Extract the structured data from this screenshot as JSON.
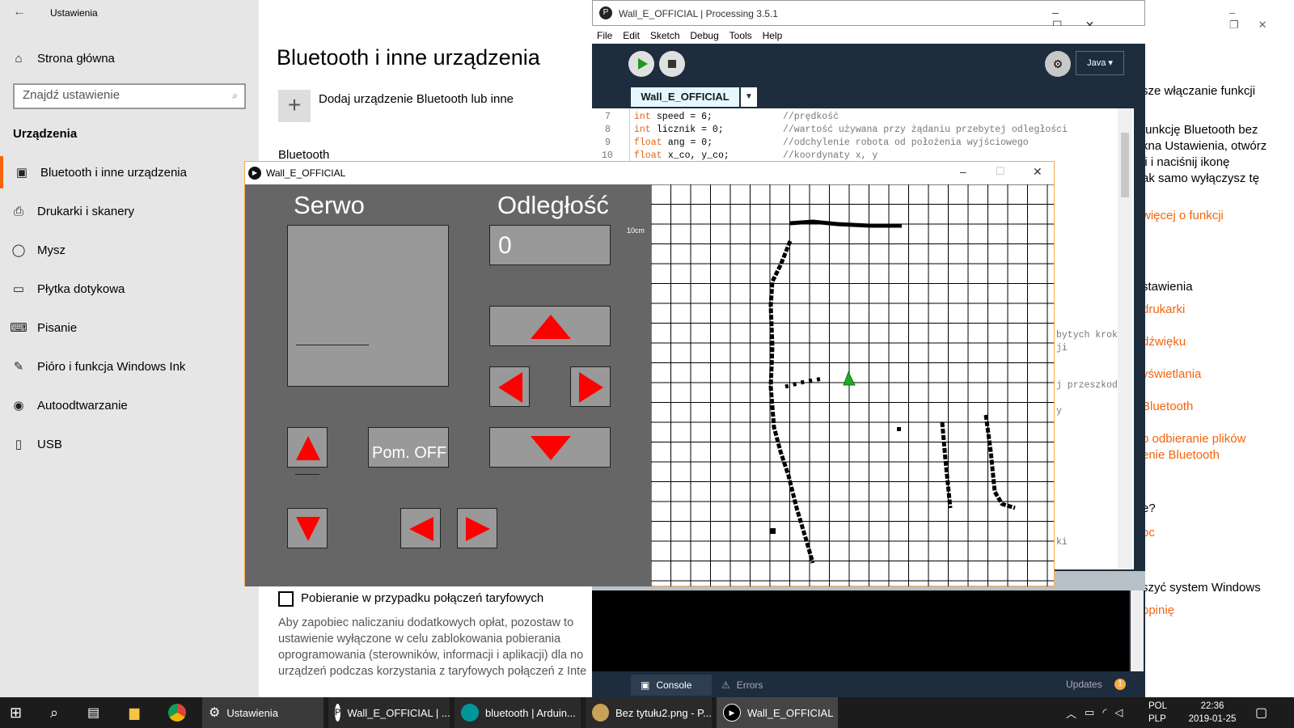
{
  "settings": {
    "window_title": "Ustawienia",
    "home": "Strona główna",
    "search_placeholder": "Znajdź ustawienie",
    "section": "Urządzenia",
    "items": [
      {
        "label": "Bluetooth i inne urządzenia",
        "icon": "bluetooth-devices-icon"
      },
      {
        "label": "Drukarki i skanery",
        "icon": "printer-icon"
      },
      {
        "label": "Mysz",
        "icon": "mouse-icon"
      },
      {
        "label": "Płytka dotykowa",
        "icon": "touchpad-icon"
      },
      {
        "label": "Pisanie",
        "icon": "keyboard-icon"
      },
      {
        "label": "Pióro i funkcja Windows Ink",
        "icon": "pen-icon"
      },
      {
        "label": "Autoodtwarzanie",
        "icon": "autoplay-icon"
      },
      {
        "label": "USB",
        "icon": "usb-icon"
      }
    ],
    "main_title": "Bluetooth i inne urządzenia",
    "add_device": "Dodaj urządzenie Bluetooth lub inne",
    "bluetooth_label": "Bluetooth",
    "metered_label": "Pobieranie w przypadku połączeń taryfowych",
    "metered_desc": [
      "Aby zapobiec naliczaniu dodatkowych opłat, pozostaw to",
      "ustawienie wyłączone w celu zablokowania pobierania",
      "oprogramowania (sterowników, informacji i aplikacji) dla no",
      "urządzeń podczas korzystania z taryfowych połączeń z Inte"
    ],
    "right_strip": [
      {
        "text": "sze włączanie funkcji",
        "link": false
      },
      {
        "text": "funkcję Bluetooth bez",
        "link": false
      },
      {
        "text": "kna Ustawienia, otwórz",
        "link": false
      },
      {
        "text": "ji i naciśnij ikonę",
        "link": false
      },
      {
        "text": "ak samo wyłączysz tę",
        "link": false
      },
      {
        "text": "więcej o funkcji",
        "link": true
      },
      {
        "text": "stawienia",
        "link": false
      },
      {
        "text": "drukarki",
        "link": true
      },
      {
        "text": "dźwięku",
        "link": true
      },
      {
        "text": "yświetlania",
        "link": true
      },
      {
        "text": "Bluetooth",
        "link": true
      },
      {
        "text": "b odbieranie plików",
        "link": true
      },
      {
        "text": "enie Bluetooth",
        "link": true
      },
      {
        "text": "e?",
        "link": false
      },
      {
        "text": "oc",
        "link": true
      },
      {
        "text": "szyć system Windows",
        "link": false
      },
      {
        "text": "opinię",
        "link": true
      }
    ]
  },
  "ide": {
    "title": "Wall_E_OFFICIAL | Processing 3.5.1",
    "menu": [
      "File",
      "Edit",
      "Sketch",
      "Debug",
      "Tools",
      "Help"
    ],
    "mode": "Java ▾",
    "tab": "Wall_E_OFFICIAL",
    "code": [
      {
        "num": "7",
        "type": "int",
        "rest": " speed = 6;",
        "comment": "//prędkość"
      },
      {
        "num": "8",
        "type": "int",
        "rest": " licznik = 0;",
        "comment": "//wartość używana przy żądaniu przebytej odległości"
      },
      {
        "num": "9",
        "type": "float",
        "rest": " ang = 0;",
        "comment": "//odchylenie robota od położenia wyjściowego"
      },
      {
        "num": "10",
        "type": "float",
        "rest": " x_co, y_co;",
        "comment": "//koordynaty x, y"
      }
    ],
    "code_fragments": [
      "bytych kroka",
      "ji",
      "j przeszkodz",
      "y",
      "ki"
    ],
    "console_tab": "Console",
    "errors_tab": "Errors",
    "updates": "Updates",
    "updates_count": "1"
  },
  "sketch": {
    "title": "Wall_E_OFFICIAL",
    "servo_label": "Serwo",
    "distance_label": "Odległość",
    "distance_value": "0",
    "measure_button": "Pom. OFF",
    "scale_label": "10cm",
    "colors": {
      "panel": "#666666",
      "button": "#999999",
      "arrow": "#ff0000",
      "robot": "#22aa22"
    }
  },
  "taskbar": {
    "apps": [
      {
        "label": "Ustawienia"
      },
      {
        "label": "Wall_E_OFFICIAL | ..."
      },
      {
        "label": "bluetooth | Arduin..."
      },
      {
        "label": "Bez tytułu2.png - P..."
      },
      {
        "label": "Wall_E_OFFICIAL"
      }
    ],
    "lang1": "POL",
    "lang2": "PLP",
    "time": "22:36",
    "date": "2019-01-25"
  }
}
